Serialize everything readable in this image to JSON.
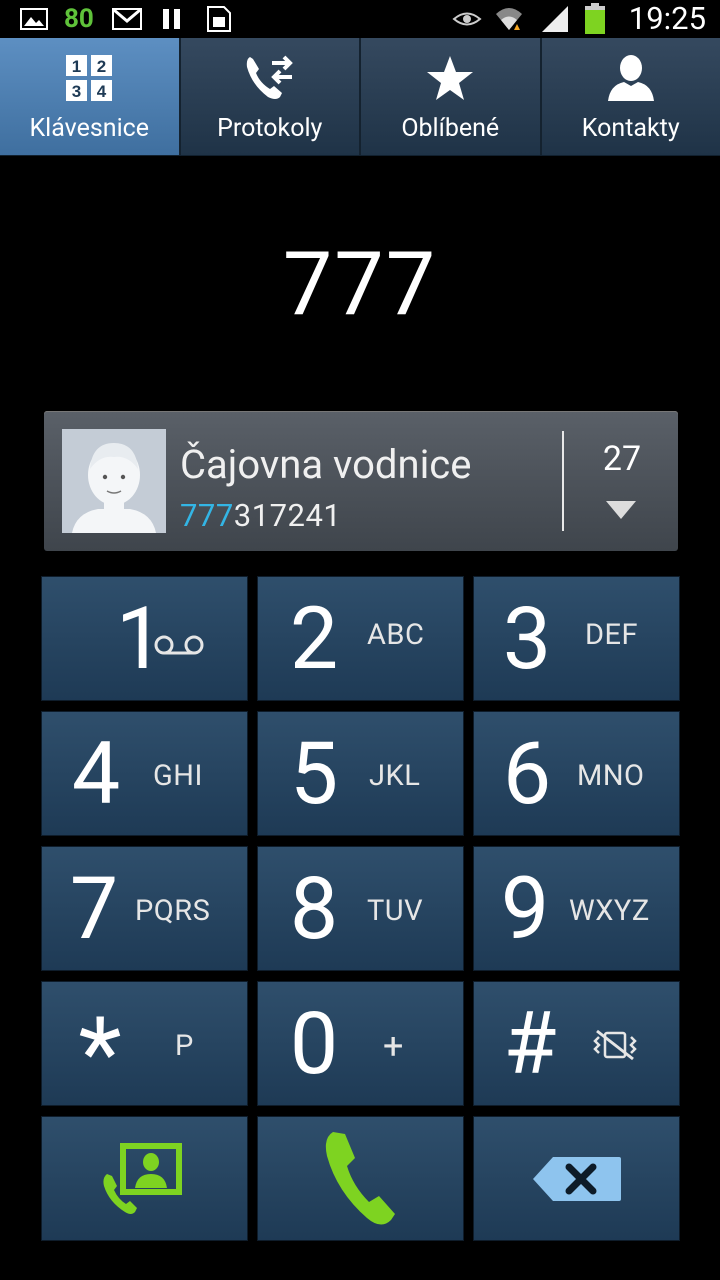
{
  "status_bar": {
    "left_value": "80",
    "time": "19:25",
    "icons": [
      "image-icon",
      "gmail-icon",
      "pause-icon",
      "sim-icon",
      "eye-icon",
      "wifi-icon",
      "signal-icon",
      "battery-icon"
    ]
  },
  "tabs": [
    {
      "label": "Klávesnice",
      "icon": "keypad-icon",
      "active": true
    },
    {
      "label": "Protokoly",
      "icon": "call-log-icon",
      "active": false
    },
    {
      "label": "Oblíbené",
      "icon": "star-icon",
      "active": false
    },
    {
      "label": "Kontakty",
      "icon": "contact-icon",
      "active": false
    }
  ],
  "dialed_number": "777",
  "suggestion": {
    "name": "Čajovna vodnice",
    "number_match": "777",
    "number_rest": "317241",
    "count": "27"
  },
  "keys": [
    {
      "digit": "1",
      "letters": ""
    },
    {
      "digit": "2",
      "letters": "ABC"
    },
    {
      "digit": "3",
      "letters": "DEF"
    },
    {
      "digit": "4",
      "letters": "GHI"
    },
    {
      "digit": "5",
      "letters": "JKL"
    },
    {
      "digit": "6",
      "letters": "MNO"
    },
    {
      "digit": "7",
      "letters": "PQRS"
    },
    {
      "digit": "8",
      "letters": "TUV"
    },
    {
      "digit": "9",
      "letters": "WXYZ"
    },
    {
      "digit": "*",
      "letters": "P"
    },
    {
      "digit": "0",
      "letters": "+"
    },
    {
      "digit": "#",
      "letters": ""
    }
  ],
  "colors": {
    "accent_green": "#7ed321",
    "match_blue": "#33b5e5"
  }
}
